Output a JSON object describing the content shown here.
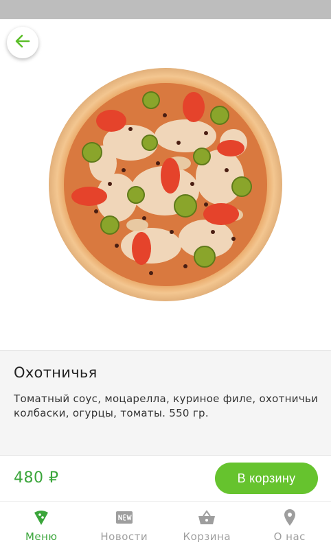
{
  "product": {
    "name": "Охотничья",
    "description": "Томатный соус, моцарелла, куриное филе, охотничьи колбаски, огурцы, томаты. 550 гр.",
    "price": "480 ₽",
    "add_to_cart_label": "В корзину",
    "image_icon": "pizza-image"
  },
  "nav": {
    "back_icon": "arrow-left-icon"
  },
  "tabs": [
    {
      "label": "Меню",
      "icon": "pizza-slice-icon",
      "active": true
    },
    {
      "label": "Новости",
      "icon": "new-badge-icon",
      "active": false
    },
    {
      "label": "Корзина",
      "icon": "basket-icon",
      "active": false
    },
    {
      "label": "О нас",
      "icon": "location-pin-icon",
      "active": false
    }
  ],
  "colors": {
    "accent": "#66c32e",
    "price": "#3aa53a",
    "inactive": "#9e9e9e",
    "status_bar": "#bdbdbd"
  }
}
